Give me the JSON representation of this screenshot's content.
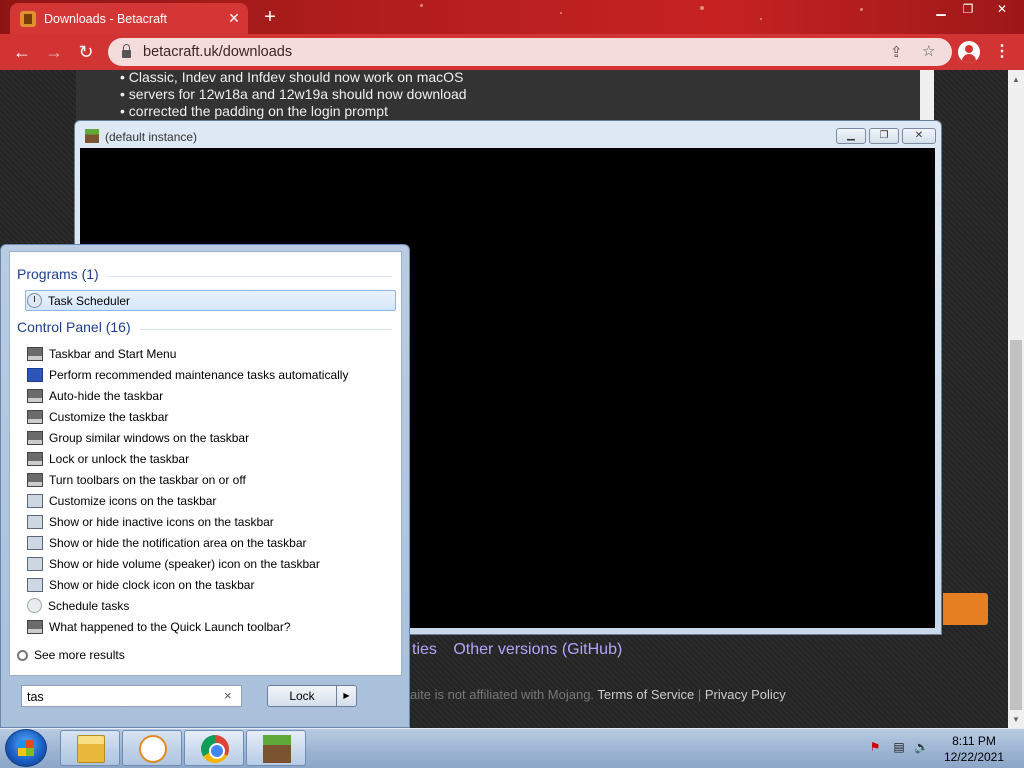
{
  "browser": {
    "tab_title": "Downloads - Betacraft",
    "tab_close": "✕",
    "new_tab": "+",
    "url": "betacraft.uk/downloads",
    "win_min": "▁",
    "win_max": "❐",
    "win_close": "✕"
  },
  "page": {
    "changelog": [
      "• Classic, Indev and Infdev should now work on macOS",
      "• servers for 12w18a and 12w19a should now download",
      "• corrected the padding on the login prompt"
    ],
    "links_partial": "ties",
    "other_versions": "Other versions (GitHub)",
    "footer_text": "aite is not affiliated with Mojang.",
    "terms": "Terms of Service",
    "separator": "|",
    "privacy": "Privacy Policy"
  },
  "minecraft_window": {
    "title": "(default instance)"
  },
  "start_menu": {
    "programs_header": "Programs (1)",
    "programs": [
      {
        "label": "Task Scheduler",
        "icon": "clock-icon"
      }
    ],
    "control_panel_header": "Control Panel (16)",
    "control_panel": [
      {
        "label": "Taskbar and Start Menu",
        "icon": "taskbar-icon"
      },
      {
        "label": "Perform recommended maintenance tasks automatically",
        "icon": "maintenance-icon"
      },
      {
        "label": "Auto-hide the taskbar",
        "icon": "taskbar-icon"
      },
      {
        "label": "Customize the taskbar",
        "icon": "taskbar-icon"
      },
      {
        "label": "Group similar windows on the taskbar",
        "icon": "taskbar-icon"
      },
      {
        "label": "Lock or unlock the taskbar",
        "icon": "taskbar-icon"
      },
      {
        "label": "Turn toolbars on the taskbar on or off",
        "icon": "taskbar-icon"
      },
      {
        "label": "Customize icons on the taskbar",
        "icon": "monitor-icon"
      },
      {
        "label": "Show or hide inactive icons on the taskbar",
        "icon": "monitor-icon"
      },
      {
        "label": "Show or hide the notification area on the taskbar",
        "icon": "monitor-icon"
      },
      {
        "label": "Show or hide volume (speaker) icon on the taskbar",
        "icon": "monitor-icon"
      },
      {
        "label": "Show or hide clock icon on the taskbar",
        "icon": "monitor-icon"
      },
      {
        "label": "Schedule tasks",
        "icon": "schedule-icon"
      },
      {
        "label": "What happened to the Quick Launch toolbar?",
        "icon": "taskbar-icon"
      }
    ],
    "see_more": "See more results",
    "search_value": "tas",
    "search_clear": "×",
    "lock_label": "Lock",
    "lock_arrow": "▶"
  },
  "taskbar": {
    "time": "8:11 PM",
    "date": "12/22/2021",
    "apps": [
      "folder-icon",
      "media-player-icon",
      "chrome-icon",
      "minecraft-icon"
    ]
  },
  "colors": {
    "chrome_red": "#d23434",
    "link_purple": "#b3a4ff",
    "orange_button": "#e67e22"
  }
}
